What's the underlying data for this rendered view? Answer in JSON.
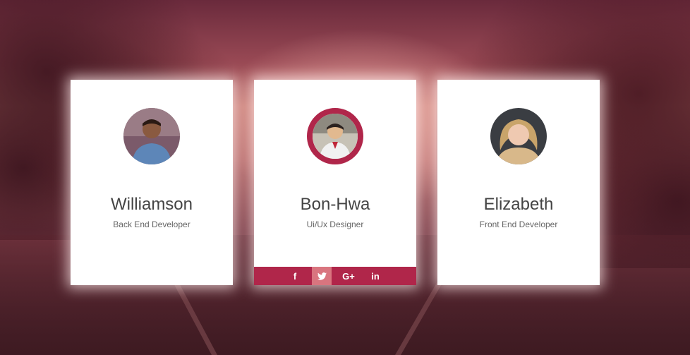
{
  "members": [
    {
      "name": "Williamson",
      "role": "Back End Developer"
    },
    {
      "name": "Bon-Hwa",
      "role": "Ui/Ux Designer"
    },
    {
      "name": "Elizabeth",
      "role": "Front End Developer"
    }
  ],
  "social": [
    {
      "label": "f",
      "icon": "facebook-icon"
    },
    {
      "label": "🐦",
      "icon": "twitter-icon"
    },
    {
      "label": "G+",
      "icon": "google-plus-icon"
    },
    {
      "label": "in",
      "icon": "linkedin-icon"
    }
  ],
  "colors": {
    "accent": "#b0264a",
    "accent_hover": "#d9757f",
    "card": "#ffffff"
  }
}
